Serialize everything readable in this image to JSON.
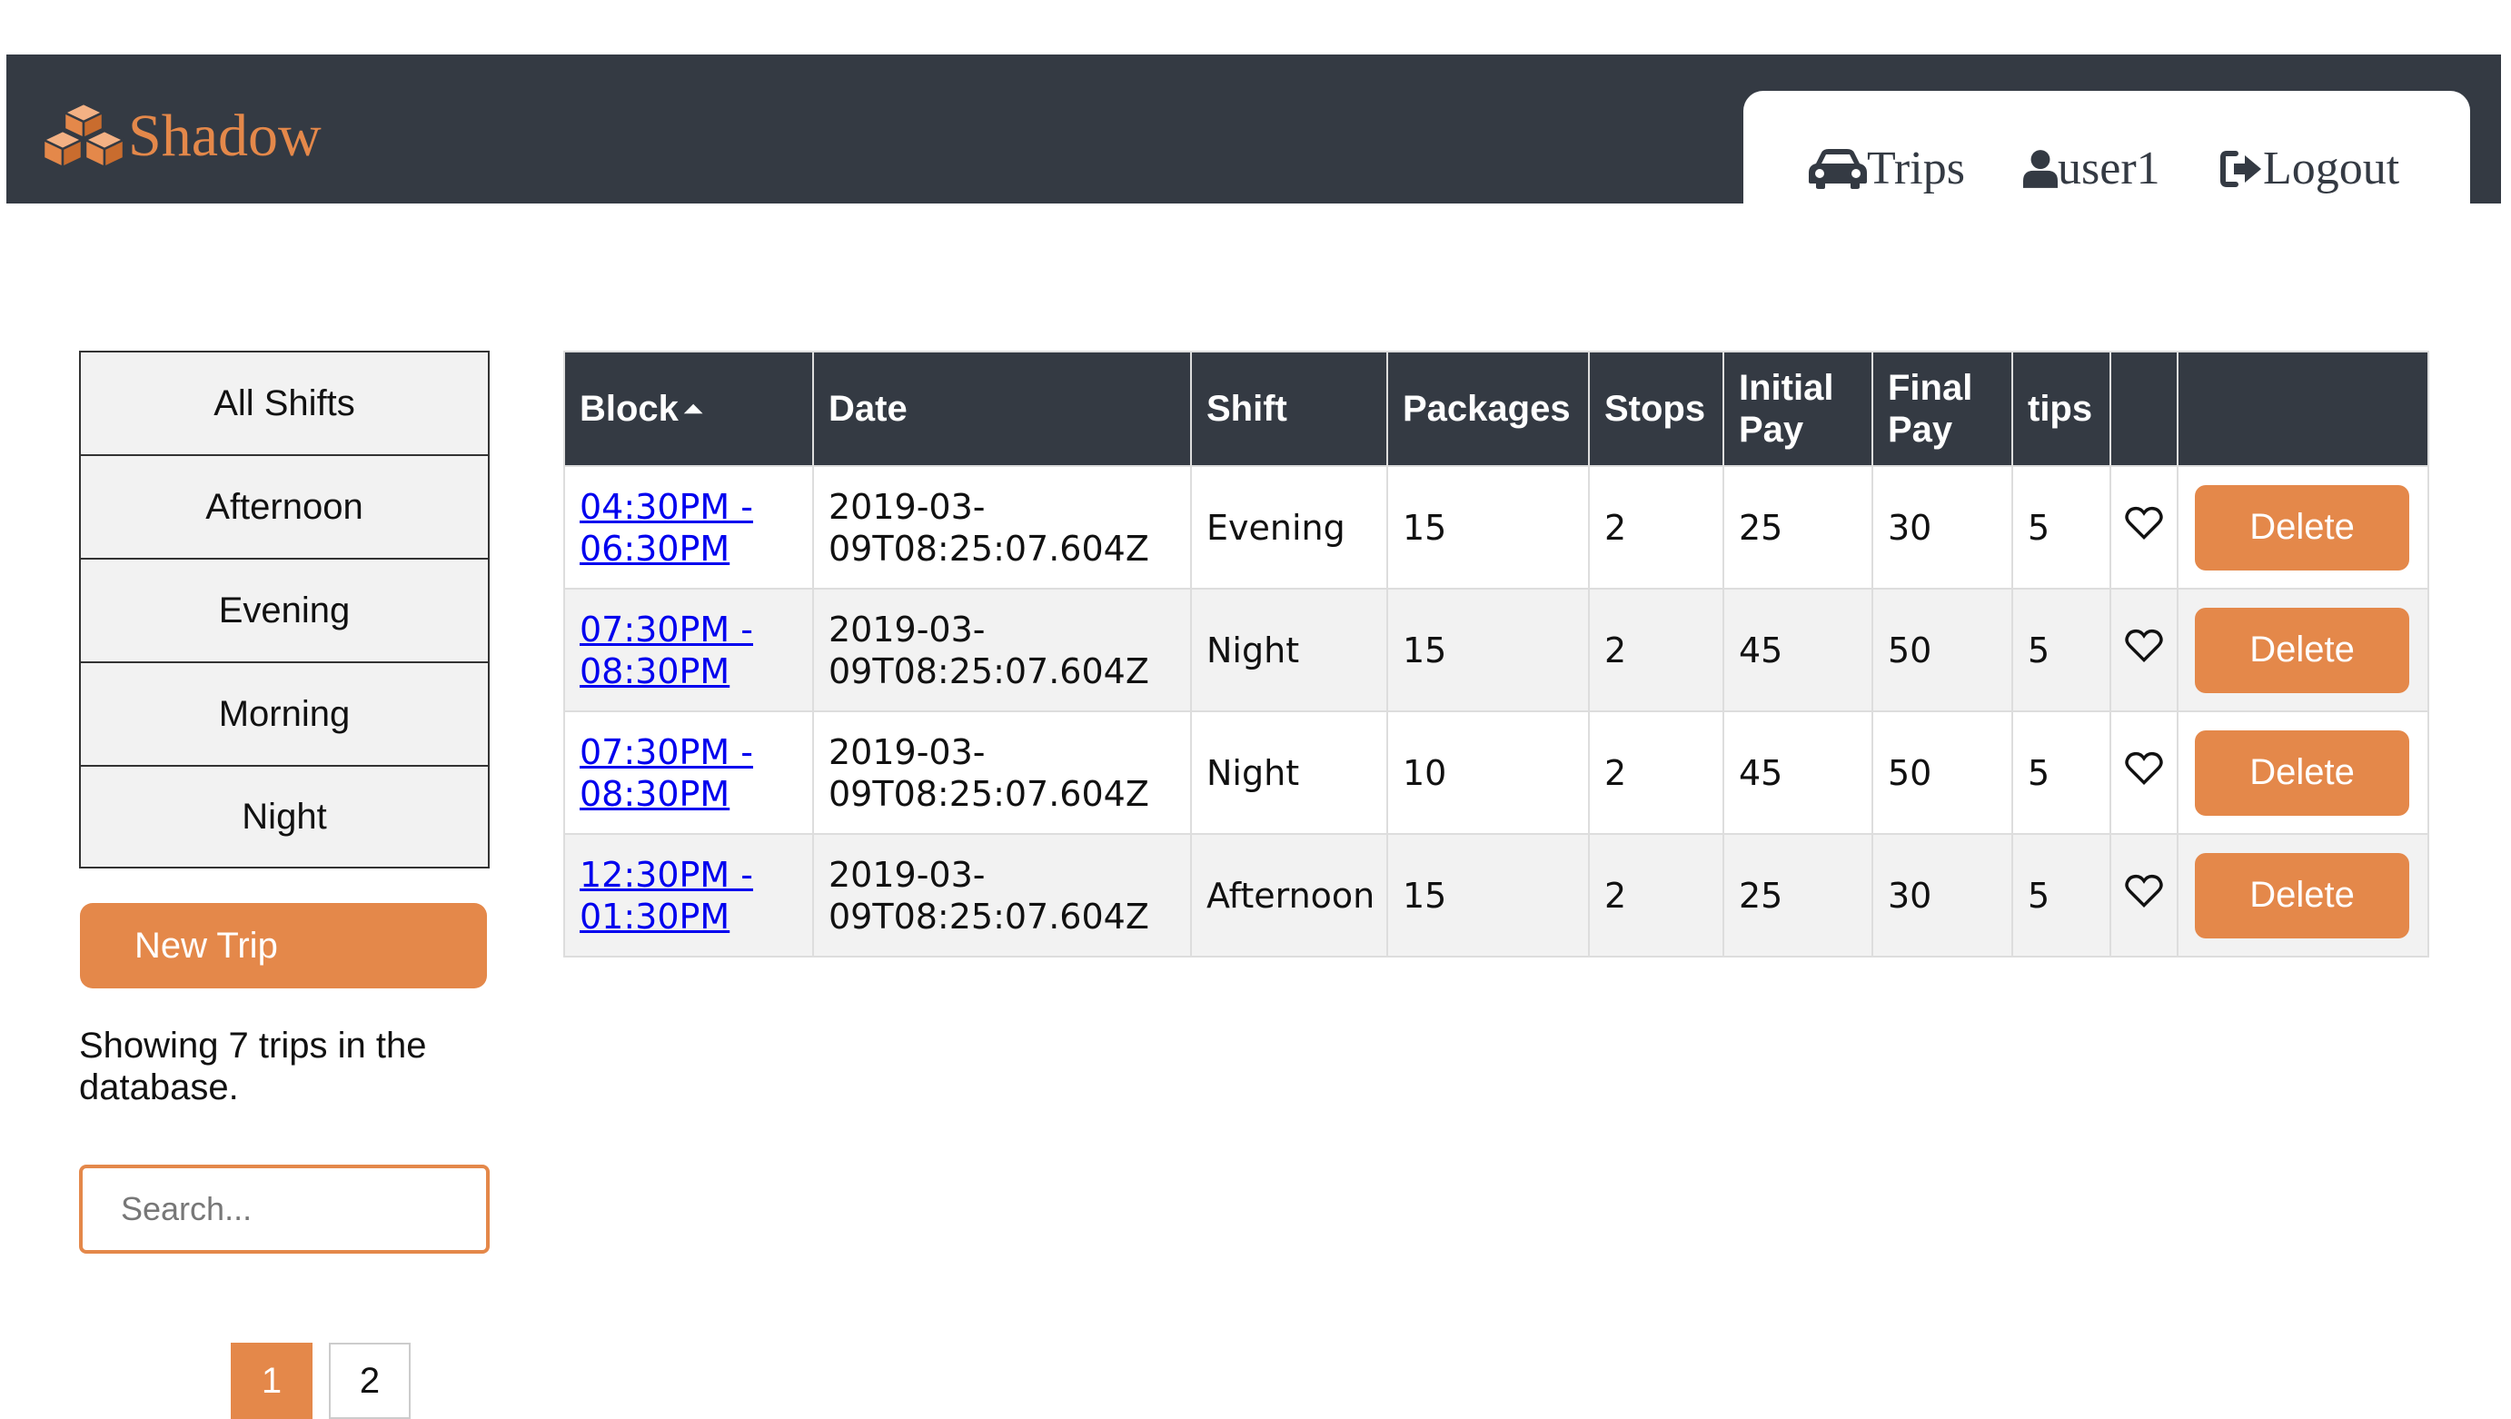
{
  "brand": {
    "name": "Shadow",
    "icon": "cubes-icon"
  },
  "nav": {
    "trips": {
      "label": "Trips",
      "icon": "car-icon"
    },
    "user": {
      "label": "user1",
      "icon": "user-icon"
    },
    "logout": {
      "label": "Logout",
      "icon": "sign-out-icon"
    }
  },
  "sidebar": {
    "shifts": [
      "All Shifts",
      "Afternoon",
      "Evening",
      "Morning",
      "Night"
    ],
    "new_trip_label": "New Trip",
    "trip_count_text": "Showing 7 trips in the database.",
    "search_placeholder": "Search...",
    "pages": [
      "1",
      "2"
    ],
    "active_page": "1"
  },
  "table": {
    "headers": {
      "block": "Block",
      "date": "Date",
      "shift": "Shift",
      "packages": "Packages",
      "stops": "Stops",
      "initial_pay": "Initial Pay",
      "final_pay": "Final Pay",
      "tips": "tips"
    },
    "sort_indicator": "⏶",
    "delete_label": "Delete",
    "rows": [
      {
        "block": "04:30PM - 06:30PM",
        "date": "2019-03-09T08:25:07.604Z",
        "shift": "Evening",
        "packages": "15",
        "stops": "2",
        "initial_pay": "25",
        "final_pay": "30",
        "tips": "5"
      },
      {
        "block": "07:30PM - 08:30PM",
        "date": "2019-03-09T08:25:07.604Z",
        "shift": "Night",
        "packages": "15",
        "stops": "2",
        "initial_pay": "45",
        "final_pay": "50",
        "tips": "5"
      },
      {
        "block": "07:30PM - 08:30PM",
        "date": "2019-03-09T08:25:07.604Z",
        "shift": "Night",
        "packages": "10",
        "stops": "2",
        "initial_pay": "45",
        "final_pay": "50",
        "tips": "5"
      },
      {
        "block": "12:30PM - 01:30PM",
        "date": "2019-03-09T08:25:07.604Z",
        "shift": "Afternoon",
        "packages": "15",
        "stops": "2",
        "initial_pay": "25",
        "final_pay": "30",
        "tips": "5"
      }
    ]
  },
  "colors": {
    "accent": "#e4884a",
    "navbar": "#343a43",
    "link": "#0000ee",
    "row_alt": "#f2f2f2"
  }
}
